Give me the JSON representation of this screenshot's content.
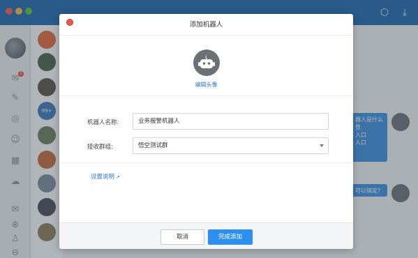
{
  "modal": {
    "title": "添加机器人",
    "edit_avatar_label": "编辑头像",
    "name_label": "机器人名称:",
    "name_value": "业务报警机器人",
    "group_label": "接收群组:",
    "group_value": "悟空测试群",
    "help_link": "设置说明",
    "cancel_label": "取消",
    "confirm_label": "完成添加"
  },
  "background": {
    "badges": [
      "1"
    ],
    "conv_badge": "99+",
    "chat_fragments": [
      "器人是什么",
      "登",
      "入口",
      "入口",
      "可以搞定?"
    ]
  },
  "colors": {
    "primary": "#2d8ff0",
    "titlebar": "#1f66ad",
    "link": "#2f7ad0",
    "close": "#e55a4e"
  },
  "icons": {
    "robot": "robot-icon",
    "external": "external-link-icon"
  }
}
